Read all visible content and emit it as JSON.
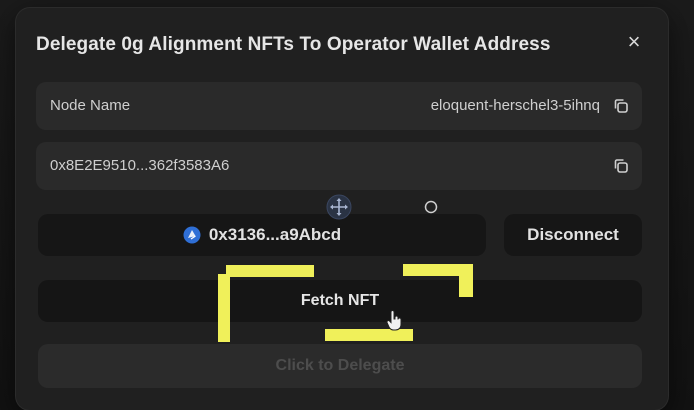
{
  "modal": {
    "title": "Delegate 0g Alignment NFTs To Operator Wallet Address",
    "close_glyph": "×"
  },
  "node_row": {
    "label": "Node Name",
    "value": "eloquent-herschel3-5ihnq"
  },
  "address_row": {
    "value": "0x8E2E9510...362f3583A6"
  },
  "wallet": {
    "address": "0x3136...a9Abcd",
    "disconnect_label": "Disconnect"
  },
  "fetch_button": {
    "label": "Fetch NFT"
  },
  "delegate_button": {
    "label": "Click to Delegate"
  },
  "colors": {
    "highlight": "#f0f05a",
    "wallet_icon": "#2f6fd6"
  }
}
